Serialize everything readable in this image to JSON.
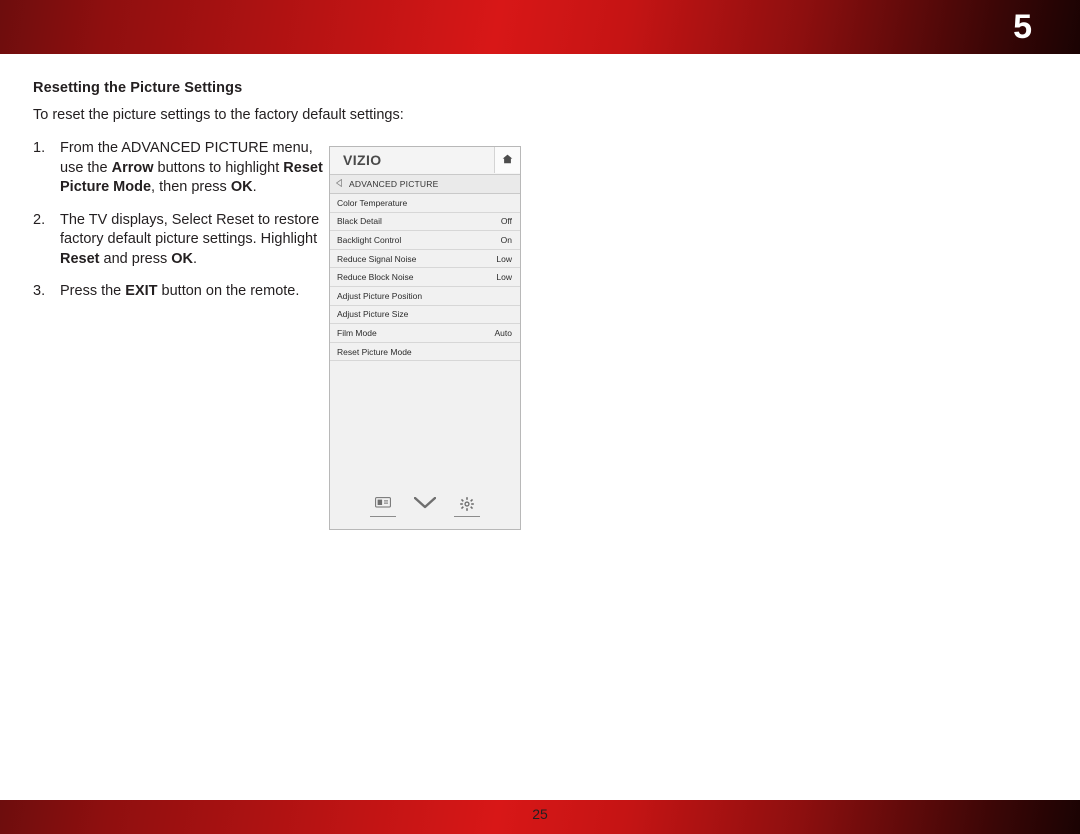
{
  "page": {
    "chapter_number": "5",
    "page_number": "25"
  },
  "article": {
    "title": "Resetting the Picture Settings",
    "intro": "To reset the picture settings to the factory default settings:",
    "steps": [
      {
        "num": "1.",
        "parts": [
          {
            "t": "From the ADVANCED PICTURE menu, use the ",
            "b": false
          },
          {
            "t": "Arrow",
            "b": true
          },
          {
            "t": " buttons to highlight ",
            "b": false
          },
          {
            "t": "Reset Picture Mode",
            "b": true
          },
          {
            "t": ", then press ",
            "b": false
          },
          {
            "t": "OK",
            "b": true
          },
          {
            "t": ".",
            "b": false
          }
        ]
      },
      {
        "num": "2.",
        "parts": [
          {
            "t": "The TV displays, Select Reset to restore factory default picture settings. Highlight ",
            "b": false
          },
          {
            "t": "Reset",
            "b": true
          },
          {
            "t": " and press ",
            "b": false
          },
          {
            "t": "OK",
            "b": true
          },
          {
            "t": ".",
            "b": false
          }
        ]
      },
      {
        "num": "3.",
        "parts": [
          {
            "t": "Press the ",
            "b": false
          },
          {
            "t": "EXIT",
            "b": true
          },
          {
            "t": " button on the remote.",
            "b": false
          }
        ]
      }
    ]
  },
  "tv_menu": {
    "logo": "VIZIO",
    "home_icon": "home-icon",
    "back_icon": "left-arrow-icon",
    "subtitle": "ADVANCED PICTURE",
    "rows": [
      {
        "label": "Color Temperature",
        "value": ""
      },
      {
        "label": "Black Detail",
        "value": "Off"
      },
      {
        "label": "Backlight Control",
        "value": "On"
      },
      {
        "label": "Reduce Signal Noise",
        "value": "Low"
      },
      {
        "label": "Reduce Block Noise",
        "value": "Low"
      },
      {
        "label": "Adjust Picture Position",
        "value": ""
      },
      {
        "label": "Adjust Picture Size",
        "value": ""
      },
      {
        "label": "Film Mode",
        "value": "Auto"
      },
      {
        "label": "Reset Picture Mode",
        "value": ""
      }
    ],
    "footer_icons": [
      "input-icon",
      "chevron-down-icon",
      "gear-icon"
    ]
  },
  "colors": {
    "banner_red": "#c11414",
    "text": "#231f20",
    "menu_bg": "#f1f1f1"
  }
}
